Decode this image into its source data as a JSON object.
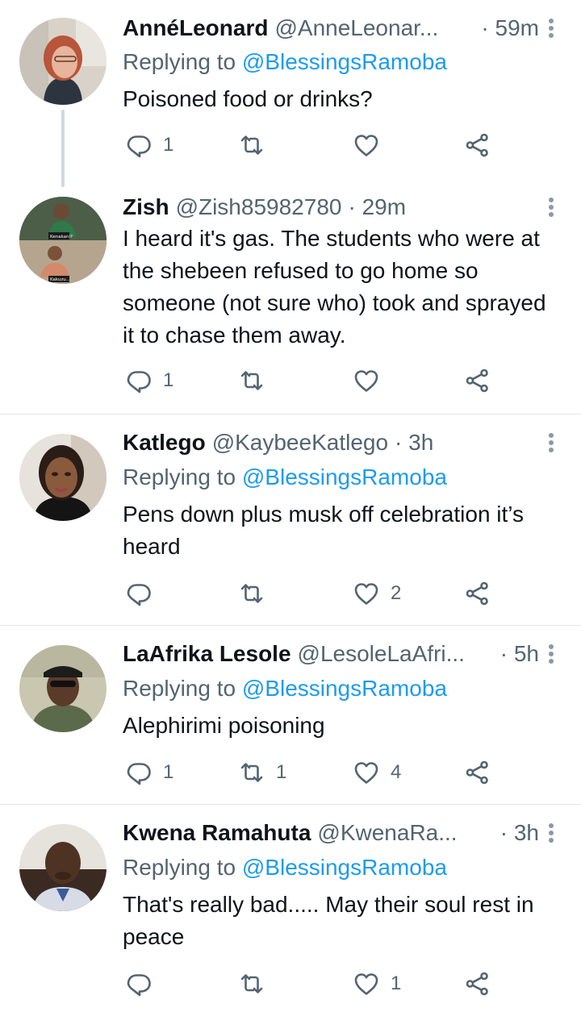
{
  "colors": {
    "text": "#0f1419",
    "secondary": "#536471",
    "mention": "#1d9bf0",
    "icon": "#536471",
    "divider": "#e6e6e6"
  },
  "tweets": [
    {
      "name": "AnnéLeonard",
      "handle": "@AnneLeonar...",
      "time": "· 59m",
      "replying_prefix": "Replying to",
      "replying_to": "@BlessingsRamoba",
      "text": "Poisoned food or drinks?",
      "replies": "1",
      "retweets": "",
      "likes": ""
    },
    {
      "name": "Zish",
      "handle": "@Zish85982780",
      "time": "· 29m",
      "text": "I heard it's gas. The students who were at the shebeen refused to go home so someone (not sure who) took and sprayed it to chase them away.",
      "replies": "1",
      "retweets": "",
      "likes": "",
      "avatar_captions": [
        "Kenakani?",
        "Kakuzu..."
      ]
    },
    {
      "name": "Katlego",
      "handle": "@KaybeeKatlego",
      "time": "· 3h",
      "replying_prefix": "Replying to",
      "replying_to": "@BlessingsRamoba",
      "text": "Pens down plus musk off celebration it’s heard",
      "replies": "",
      "retweets": "",
      "likes": "2"
    },
    {
      "name": "LaAfrika Lesole",
      "handle": "@LesoleLaAfri...",
      "time": "· 5h",
      "replying_prefix": "Replying to",
      "replying_to": "@BlessingsRamoba",
      "text": "Alephirimi poisoning",
      "replies": "1",
      "retweets": "1",
      "likes": "4"
    },
    {
      "name": "Kwena Ramahuta",
      "handle": "@KwenaRa...",
      "time": "· 3h",
      "replying_prefix": "Replying to",
      "replying_to": "@BlessingsRamoba",
      "text": "That's really bad..... May their soul rest in peace",
      "replies": "",
      "retweets": "",
      "likes": "1"
    }
  ],
  "icons": {
    "reply": "reply-icon",
    "retweet": "retweet-icon",
    "like": "heart-icon",
    "share": "share-icon",
    "more": "more-vertical-icon"
  }
}
